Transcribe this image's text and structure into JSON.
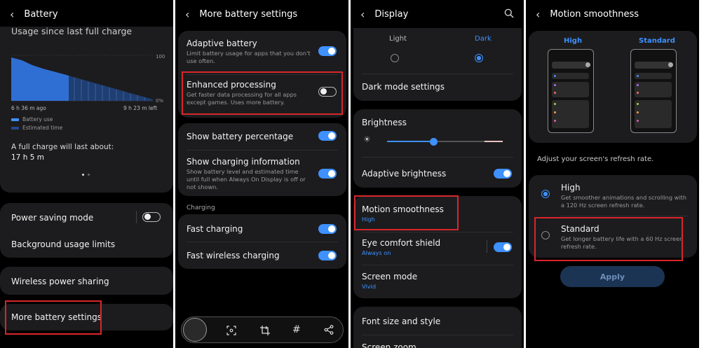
{
  "battery": {
    "title": "Battery",
    "usage_heading": "Usage since last full charge",
    "axis_top": "100",
    "axis_bottom": "0%",
    "time_ago": "6 h 36 m ago",
    "time_left": "9 h 23 m left",
    "legend_battery": "Battery use",
    "legend_estimated": "Estimated time",
    "full_charge_label": "A full charge will last about:",
    "full_charge_value": "17 h 5 m",
    "items": {
      "power_saving": "Power saving mode",
      "background_limits": "Background usage limits",
      "wireless_sharing": "Wireless power sharing",
      "more_settings": "More battery settings"
    }
  },
  "more_battery": {
    "title": "More battery settings",
    "adaptive_title": "Adaptive battery",
    "adaptive_sub": "Limit battery usage for apps that you don't use often.",
    "enhanced_title": "Enhanced processing",
    "enhanced_sub": "Get faster data processing for all apps except games. Uses more battery.",
    "show_pct": "Show battery percentage",
    "charging_info_title": "Show charging information",
    "charging_info_sub": "Show battery level and estimated time until full when Always On Display is off or not shown.",
    "charging_section": "Charging",
    "fast_charging": "Fast charging",
    "fast_wireless": "Fast wireless charging"
  },
  "display": {
    "title": "Display",
    "light": "Light",
    "dark": "Dark",
    "dark_mode_settings": "Dark mode settings",
    "brightness": "Brightness",
    "brightness_level": 0.4,
    "adaptive_brightness": "Adaptive brightness",
    "motion_title": "Motion smoothness",
    "motion_value": "High",
    "eye_title": "Eye comfort shield",
    "eye_value": "Always on",
    "screen_mode_title": "Screen mode",
    "screen_mode_value": "Vivid",
    "font_size": "Font size and style",
    "screen_zoom": "Screen zoom"
  },
  "motion": {
    "title": "Motion smoothness",
    "preview_high": "High",
    "preview_standard": "Standard",
    "adjust_text": "Adjust your screen's refresh rate.",
    "high_title": "High",
    "high_sub": "Get smoother animations and scrolling with a 120 Hz screen refresh rate.",
    "standard_title": "Standard",
    "standard_sub": "Get longer battery life with a 60 Hz screen refresh rate.",
    "apply": "Apply"
  },
  "colors": {
    "accent": "#3e91ff",
    "highlight": "#d8262b",
    "card": "#1c1c1e"
  }
}
